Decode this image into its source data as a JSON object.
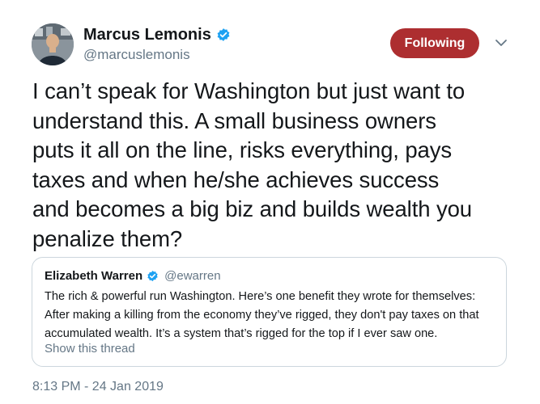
{
  "author": {
    "display_name": "Marcus Lemonis",
    "handle": "@marcuslemonis",
    "verified": true
  },
  "follow_button": {
    "label": "Following",
    "color": "#ad2e30"
  },
  "tweet": {
    "lines": [
      "I can’t speak for Washington but just want to",
      "understand this. A small business owners",
      "puts it all on the line, risks everything, pays",
      "taxes and when he/she achieves success",
      "and becomes a big biz and builds wealth you",
      "penalize them?"
    ],
    "timestamp": "8:13 PM - 24 Jan 2019"
  },
  "quoted_tweet": {
    "display_name": "Elizabeth Warren",
    "handle": "@ewarren",
    "verified": true,
    "lines": [
      "The rich & powerful run Washington. Here’s one benefit they wrote for themselves:",
      "After making a killing from the economy they’ve rigged, they don't pay taxes on that",
      "accumulated wealth. It’s a system that’s rigged for the top if I ever saw one."
    ],
    "show_thread_label": "Show this thread"
  },
  "icons": {
    "verified": "verified-badge-icon",
    "caret": "chevron-down-icon",
    "verified_color": "#1da1f2"
  }
}
